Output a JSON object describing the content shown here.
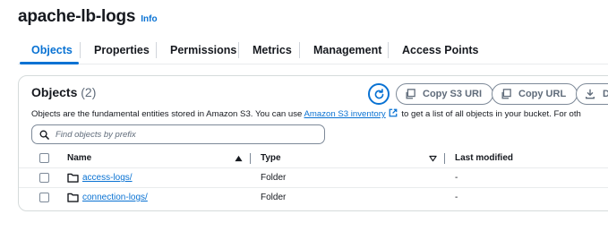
{
  "bucket": {
    "name": "apache-lb-logs",
    "info_label": "Info"
  },
  "tabs": [
    {
      "label": "Objects",
      "active": true
    },
    {
      "label": "Properties",
      "active": false
    },
    {
      "label": "Permissions",
      "active": false
    },
    {
      "label": "Metrics",
      "active": false
    },
    {
      "label": "Management",
      "active": false
    },
    {
      "label": "Access Points",
      "active": false
    }
  ],
  "objects_panel": {
    "heading": "Objects",
    "count": "(2)",
    "buttons": {
      "copy_s3_uri": "Copy S3 URI",
      "copy_url": "Copy URL",
      "download": "D"
    },
    "description": {
      "before_link": "Objects are the fundamental entities stored in Amazon S3. You can use ",
      "link_text": "Amazon S3 inventory",
      "after_link": " to get a list of all objects in your bucket. For oth"
    },
    "search": {
      "placeholder": "Find objects by prefix",
      "value": ""
    },
    "columns": {
      "name": "Name",
      "type": "Type",
      "last_modified": "Last modified"
    },
    "rows": [
      {
        "name": "access-logs/",
        "type": "Folder",
        "last_modified": "-"
      },
      {
        "name": "connection-logs/",
        "type": "Folder",
        "last_modified": "-"
      }
    ]
  },
  "colors": {
    "accent": "#0972d3",
    "text": "#16191f",
    "muted": "#5f6b7a",
    "border": "#7d8998"
  }
}
